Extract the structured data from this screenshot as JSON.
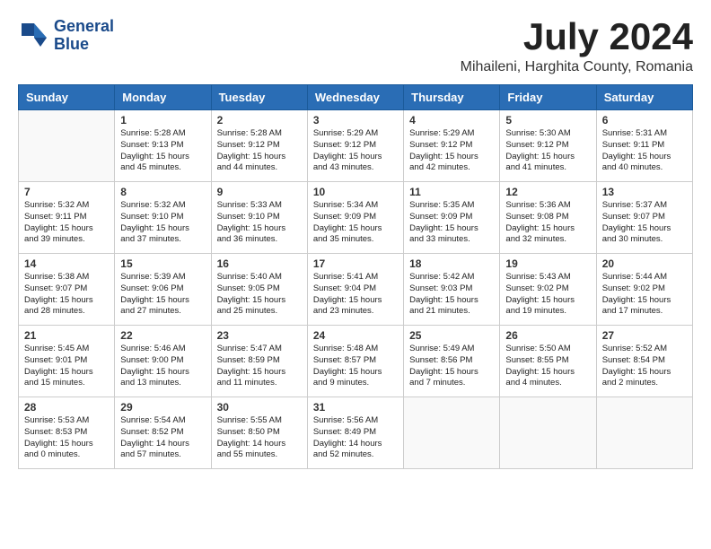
{
  "header": {
    "logo_line1": "General",
    "logo_line2": "Blue",
    "month_year": "July 2024",
    "location": "Mihaileni, Harghita County, Romania"
  },
  "days_of_week": [
    "Sunday",
    "Monday",
    "Tuesday",
    "Wednesday",
    "Thursday",
    "Friday",
    "Saturday"
  ],
  "weeks": [
    [
      {
        "day": "",
        "info": ""
      },
      {
        "day": "1",
        "info": "Sunrise: 5:28 AM\nSunset: 9:13 PM\nDaylight: 15 hours\nand 45 minutes."
      },
      {
        "day": "2",
        "info": "Sunrise: 5:28 AM\nSunset: 9:12 PM\nDaylight: 15 hours\nand 44 minutes."
      },
      {
        "day": "3",
        "info": "Sunrise: 5:29 AM\nSunset: 9:12 PM\nDaylight: 15 hours\nand 43 minutes."
      },
      {
        "day": "4",
        "info": "Sunrise: 5:29 AM\nSunset: 9:12 PM\nDaylight: 15 hours\nand 42 minutes."
      },
      {
        "day": "5",
        "info": "Sunrise: 5:30 AM\nSunset: 9:12 PM\nDaylight: 15 hours\nand 41 minutes."
      },
      {
        "day": "6",
        "info": "Sunrise: 5:31 AM\nSunset: 9:11 PM\nDaylight: 15 hours\nand 40 minutes."
      }
    ],
    [
      {
        "day": "7",
        "info": "Sunrise: 5:32 AM\nSunset: 9:11 PM\nDaylight: 15 hours\nand 39 minutes."
      },
      {
        "day": "8",
        "info": "Sunrise: 5:32 AM\nSunset: 9:10 PM\nDaylight: 15 hours\nand 37 minutes."
      },
      {
        "day": "9",
        "info": "Sunrise: 5:33 AM\nSunset: 9:10 PM\nDaylight: 15 hours\nand 36 minutes."
      },
      {
        "day": "10",
        "info": "Sunrise: 5:34 AM\nSunset: 9:09 PM\nDaylight: 15 hours\nand 35 minutes."
      },
      {
        "day": "11",
        "info": "Sunrise: 5:35 AM\nSunset: 9:09 PM\nDaylight: 15 hours\nand 33 minutes."
      },
      {
        "day": "12",
        "info": "Sunrise: 5:36 AM\nSunset: 9:08 PM\nDaylight: 15 hours\nand 32 minutes."
      },
      {
        "day": "13",
        "info": "Sunrise: 5:37 AM\nSunset: 9:07 PM\nDaylight: 15 hours\nand 30 minutes."
      }
    ],
    [
      {
        "day": "14",
        "info": "Sunrise: 5:38 AM\nSunset: 9:07 PM\nDaylight: 15 hours\nand 28 minutes."
      },
      {
        "day": "15",
        "info": "Sunrise: 5:39 AM\nSunset: 9:06 PM\nDaylight: 15 hours\nand 27 minutes."
      },
      {
        "day": "16",
        "info": "Sunrise: 5:40 AM\nSunset: 9:05 PM\nDaylight: 15 hours\nand 25 minutes."
      },
      {
        "day": "17",
        "info": "Sunrise: 5:41 AM\nSunset: 9:04 PM\nDaylight: 15 hours\nand 23 minutes."
      },
      {
        "day": "18",
        "info": "Sunrise: 5:42 AM\nSunset: 9:03 PM\nDaylight: 15 hours\nand 21 minutes."
      },
      {
        "day": "19",
        "info": "Sunrise: 5:43 AM\nSunset: 9:02 PM\nDaylight: 15 hours\nand 19 minutes."
      },
      {
        "day": "20",
        "info": "Sunrise: 5:44 AM\nSunset: 9:02 PM\nDaylight: 15 hours\nand 17 minutes."
      }
    ],
    [
      {
        "day": "21",
        "info": "Sunrise: 5:45 AM\nSunset: 9:01 PM\nDaylight: 15 hours\nand 15 minutes."
      },
      {
        "day": "22",
        "info": "Sunrise: 5:46 AM\nSunset: 9:00 PM\nDaylight: 15 hours\nand 13 minutes."
      },
      {
        "day": "23",
        "info": "Sunrise: 5:47 AM\nSunset: 8:59 PM\nDaylight: 15 hours\nand 11 minutes."
      },
      {
        "day": "24",
        "info": "Sunrise: 5:48 AM\nSunset: 8:57 PM\nDaylight: 15 hours\nand 9 minutes."
      },
      {
        "day": "25",
        "info": "Sunrise: 5:49 AM\nSunset: 8:56 PM\nDaylight: 15 hours\nand 7 minutes."
      },
      {
        "day": "26",
        "info": "Sunrise: 5:50 AM\nSunset: 8:55 PM\nDaylight: 15 hours\nand 4 minutes."
      },
      {
        "day": "27",
        "info": "Sunrise: 5:52 AM\nSunset: 8:54 PM\nDaylight: 15 hours\nand 2 minutes."
      }
    ],
    [
      {
        "day": "28",
        "info": "Sunrise: 5:53 AM\nSunset: 8:53 PM\nDaylight: 15 hours\nand 0 minutes."
      },
      {
        "day": "29",
        "info": "Sunrise: 5:54 AM\nSunset: 8:52 PM\nDaylight: 14 hours\nand 57 minutes."
      },
      {
        "day": "30",
        "info": "Sunrise: 5:55 AM\nSunset: 8:50 PM\nDaylight: 14 hours\nand 55 minutes."
      },
      {
        "day": "31",
        "info": "Sunrise: 5:56 AM\nSunset: 8:49 PM\nDaylight: 14 hours\nand 52 minutes."
      },
      {
        "day": "",
        "info": ""
      },
      {
        "day": "",
        "info": ""
      },
      {
        "day": "",
        "info": ""
      }
    ]
  ]
}
